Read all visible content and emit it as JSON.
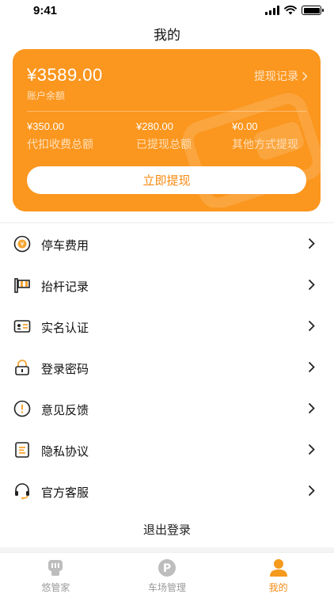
{
  "status_bar": {
    "time": "9:41"
  },
  "page": {
    "title": "我的"
  },
  "wallet": {
    "balance": "¥3589.00",
    "balance_label": "账户余额",
    "record_link": "提现记录",
    "stats": [
      {
        "value": "¥350.00",
        "label": "代扣收费总额"
      },
      {
        "value": "¥280.00",
        "label": "已提现总额"
      },
      {
        "value": "¥0.00",
        "label": "其他方式提现"
      }
    ],
    "withdraw_button": "立即提现"
  },
  "menu": {
    "items": [
      {
        "label": "停车费用",
        "icon": "yen-coin-icon"
      },
      {
        "label": "抬杆记录",
        "icon": "barrier-gate-icon"
      },
      {
        "label": "实名认证",
        "icon": "id-card-icon"
      },
      {
        "label": "登录密码",
        "icon": "lock-icon"
      },
      {
        "label": "意见反馈",
        "icon": "exclamation-icon"
      },
      {
        "label": "隐私协议",
        "icon": "document-icon"
      },
      {
        "label": "官方客服",
        "icon": "headset-icon"
      }
    ]
  },
  "logout_label": "退出登录",
  "tabbar": {
    "items": [
      {
        "label": "悠管家",
        "icon": "butler-icon",
        "active": false
      },
      {
        "label": "车场管理",
        "icon": "parking-icon",
        "active": false
      },
      {
        "label": "我的",
        "icon": "user-icon",
        "active": true
      }
    ]
  },
  "colors": {
    "accent": "#fb961e",
    "accent_text": "#f68a10",
    "inactive_tab": "#9a9a9a"
  }
}
